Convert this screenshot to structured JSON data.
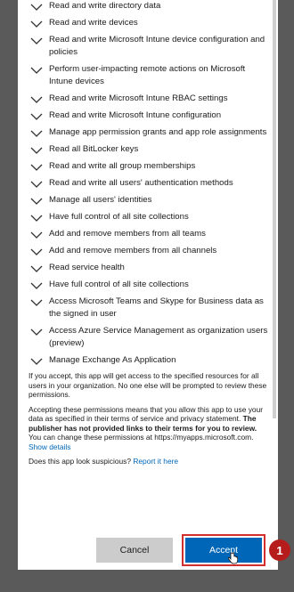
{
  "permissions": [
    "Read and write directory data",
    "Read and write devices",
    "Read and write Microsoft Intune device configuration and policies",
    "Perform user-impacting remote actions on Microsoft Intune devices",
    "Read and write Microsoft Intune RBAC settings",
    "Read and write Microsoft Intune configuration",
    "Manage app permission grants and app role assignments",
    "Read all BitLocker keys",
    "Read and write all group memberships",
    "Read and write all users' authentication methods",
    "Manage all users' identities",
    "Have full control of all site collections",
    "Add and remove members from all teams",
    "Add and remove members from all channels",
    "Read service health",
    "Have full control of all site collections",
    "Access Microsoft Teams and Skype for Business data as the signed in user",
    "Access Azure Service Management as organization users (preview)",
    "Manage Exchange As Application"
  ],
  "info": {
    "paragraph1": "If you accept, this app will get access to the specified resources for all users in your organization. No one else will be prompted to review these permissions.",
    "paragraph2_start": "Accepting these permissions means that you allow this app to use your data as specified in their terms of service and privacy statement.",
    "paragraph2_bold": "The publisher has not provided links to their terms for you to review.",
    "paragraph2_end": "You can change these permissions at https://myapps.microsoft.com.",
    "show_details": "Show details",
    "suspicious_question": "Does this app look suspicious?",
    "report_link": "Report it here"
  },
  "buttons": {
    "cancel": "Cancel",
    "accept": "Accept"
  },
  "callout_number": "1"
}
